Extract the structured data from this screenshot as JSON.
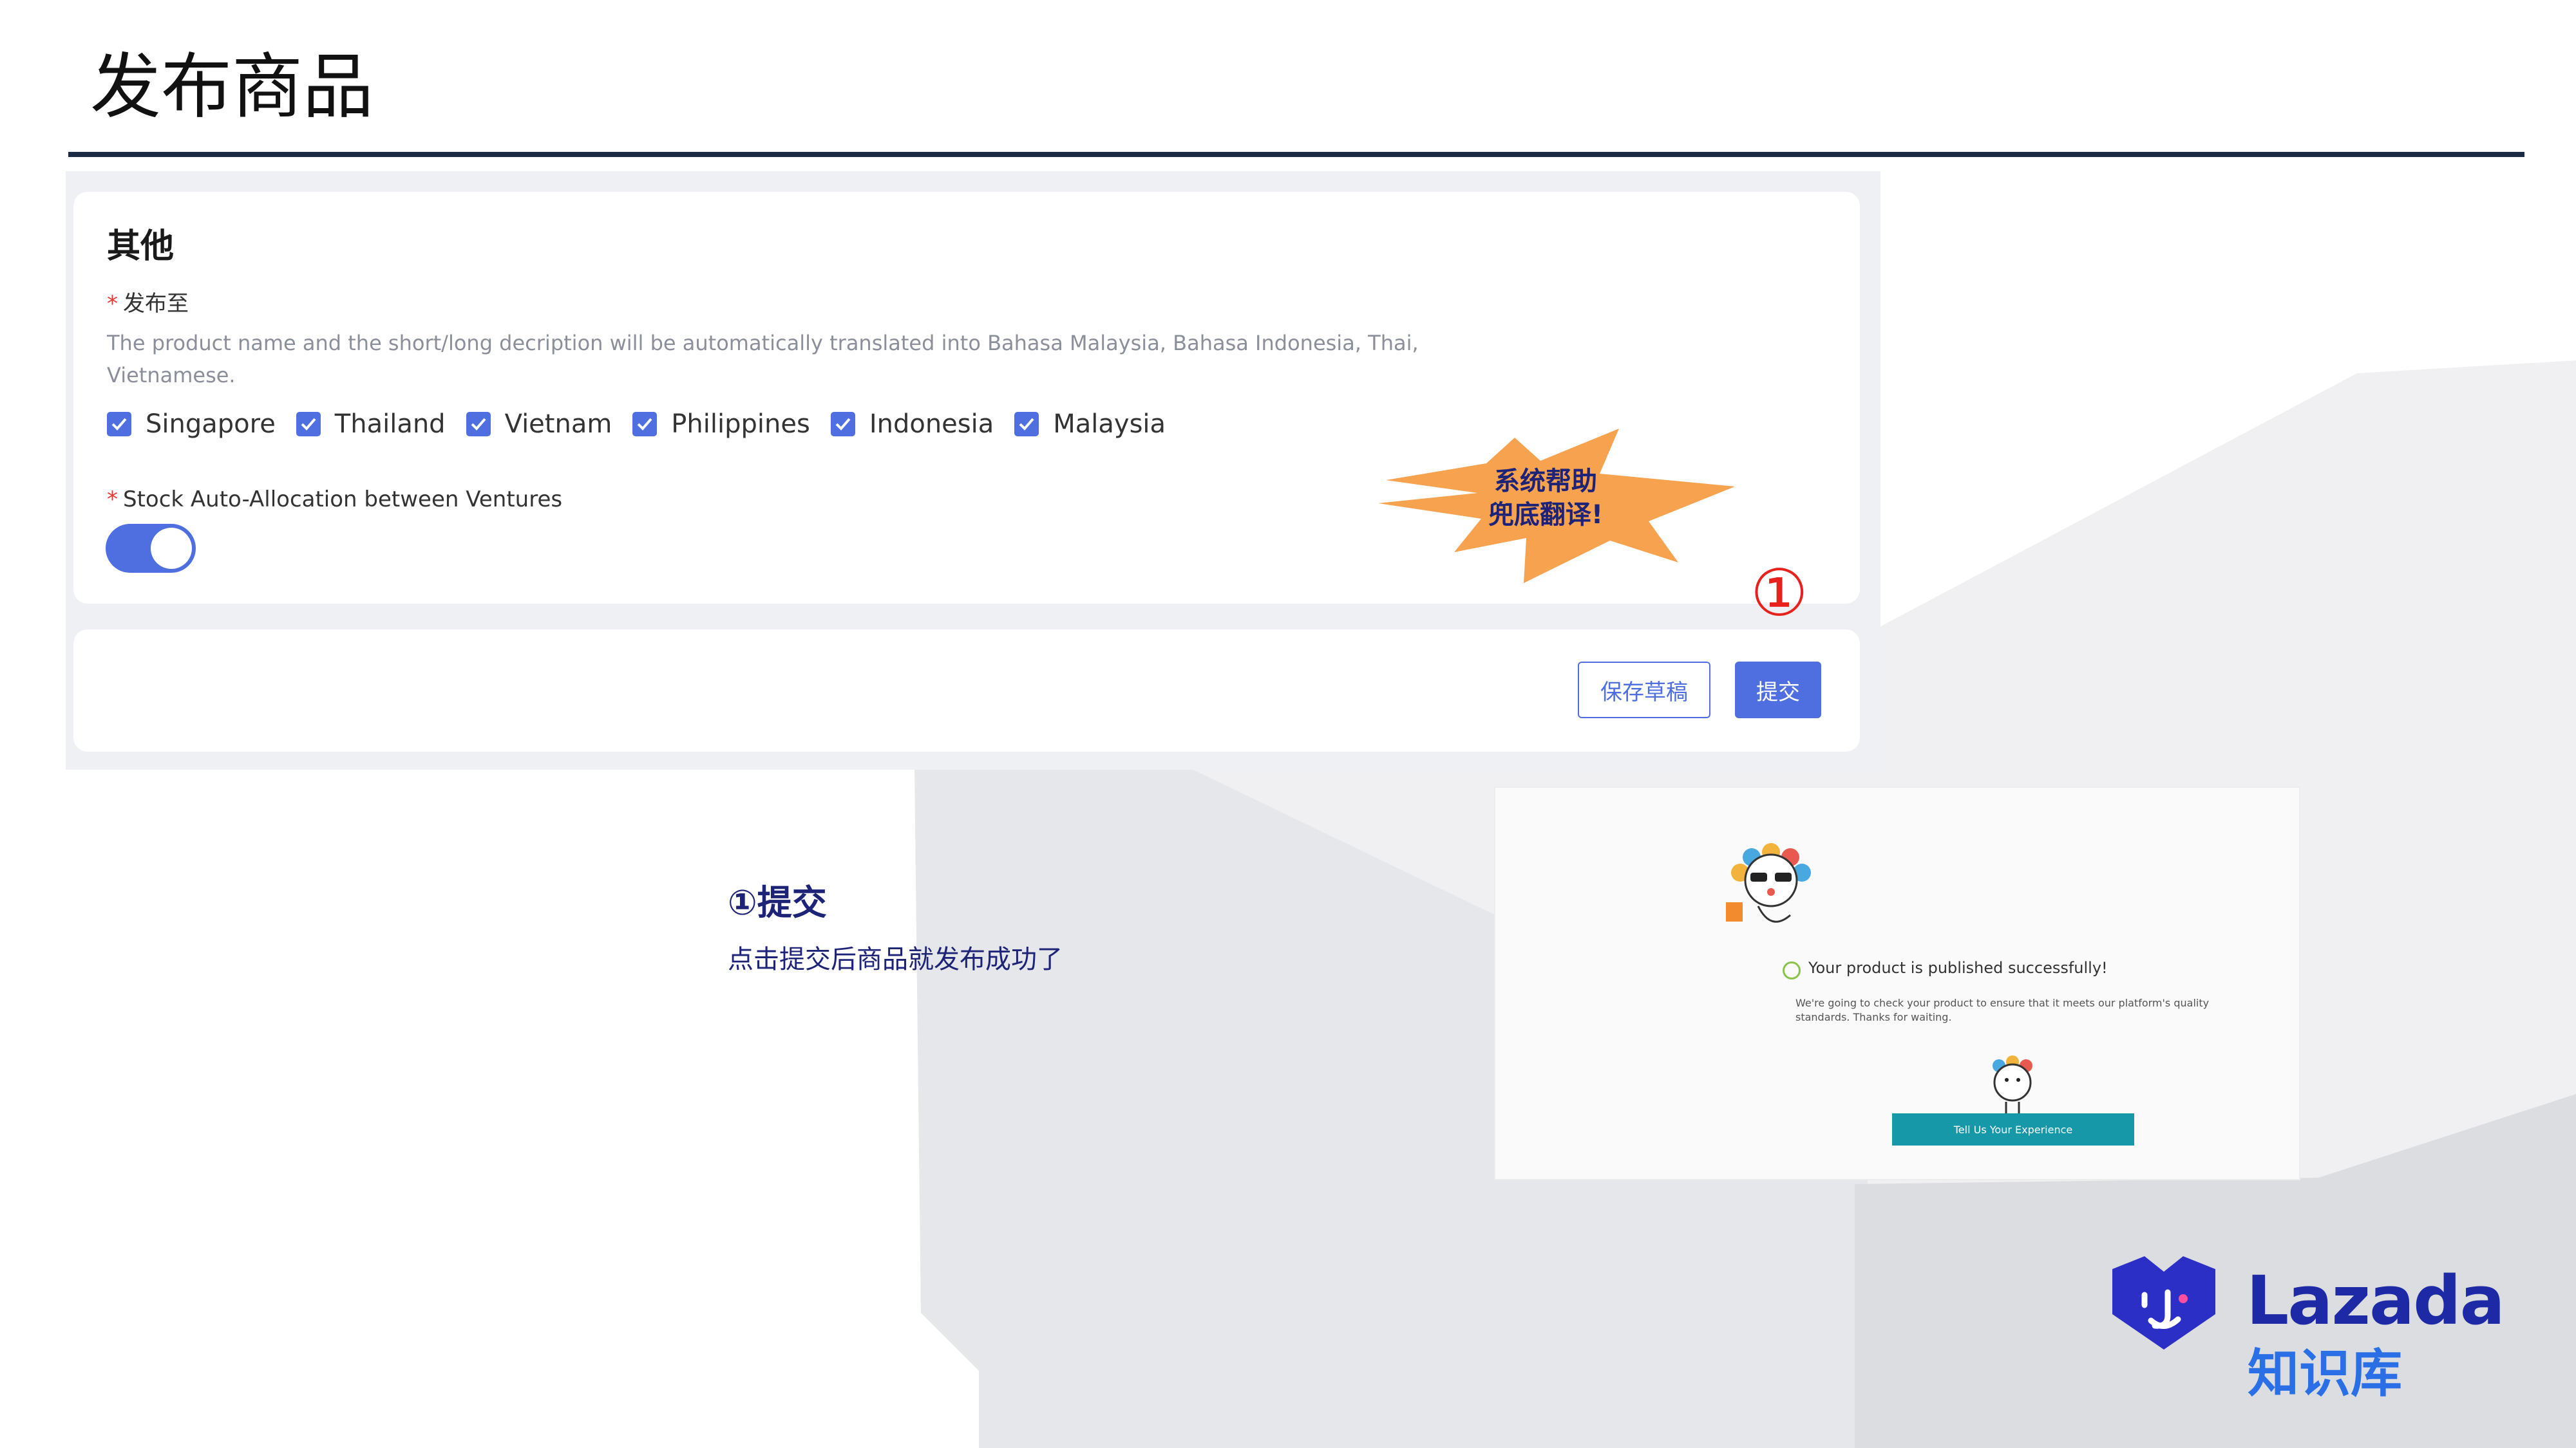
{
  "slide": {
    "title": "发布商品"
  },
  "form": {
    "section_title": "其他",
    "publish_to": {
      "required_mark": "*",
      "label": "发布至",
      "help": "The product name and the short/long decription will be automatically translated into Bahasa Malaysia, Bahasa Indonesia, Thai, Vietnamese.",
      "countries": [
        {
          "label": "Singapore",
          "checked": true
        },
        {
          "label": "Thailand",
          "checked": true
        },
        {
          "label": "Vietnam",
          "checked": true
        },
        {
          "label": "Philippines",
          "checked": true
        },
        {
          "label": "Indonesia",
          "checked": true
        },
        {
          "label": "Malaysia",
          "checked": true
        }
      ]
    },
    "stock": {
      "required_mark": "*",
      "label": "Stock Auto-Allocation between Ventures",
      "enabled": true
    },
    "buttons": {
      "draft": "保存草稿",
      "submit": "提交"
    }
  },
  "callout": {
    "line1": "系统帮助",
    "line2": "兜底翻译!"
  },
  "marker": "①",
  "step": {
    "title": "①提交",
    "desc": "点击提交后商品就发布成功了"
  },
  "success": {
    "message": "Your product is published successfully!",
    "sub": "We're going to check your product to ensure that it meets our platform's quality standards. Thanks for waiting.",
    "button": "Tell Us Your Experience"
  },
  "logo": {
    "name": "Lazada",
    "sub": "知识库"
  },
  "colors": {
    "primary": "#4f6fe0",
    "navy": "#1d2377",
    "burst": "#f7a24e",
    "marker": "#e8211c",
    "teal": "#1798a8"
  }
}
